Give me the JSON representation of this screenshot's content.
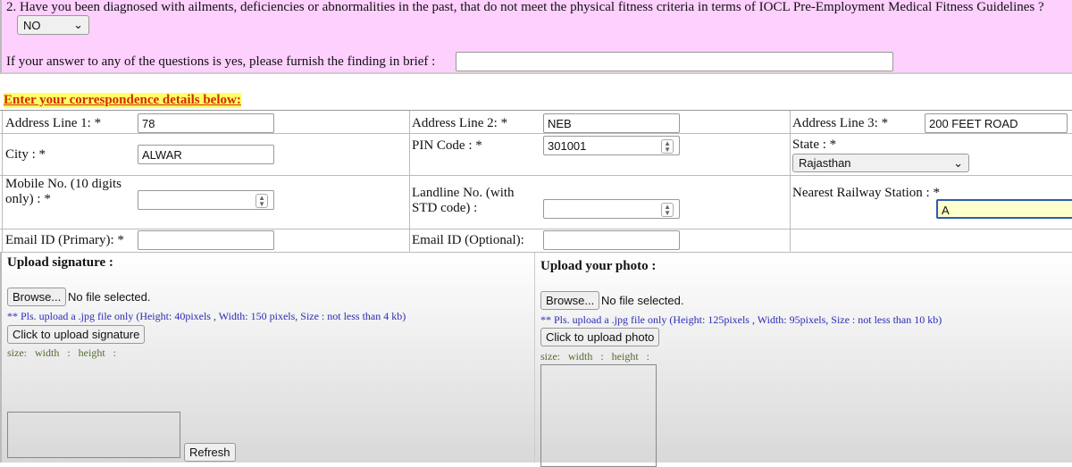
{
  "medical": {
    "question": "2. Have you been diagnosed with ailments, deficiencies or abnormalities in the past, that do not meet the physical fitness criteria in terms of IOCL Pre-Employment Medical Fitness Guidelines ?",
    "answer": "NO",
    "finding_label": "If your answer to any of the questions is yes, please furnish the finding in brief :",
    "finding_value": ""
  },
  "correspondence": {
    "heading": "Enter your correspondence details below:",
    "address1_label": "Address Line 1: *",
    "address1": "78",
    "address2_label": "Address Line 2: *",
    "address2": "NEB",
    "address3_label": "Address Line 3: *",
    "address3": "200 FEET ROAD",
    "city_label": "City : *",
    "city": "ALWAR",
    "pin_label": "PIN Code : *",
    "pin": "301001",
    "state_label": "State : *",
    "state": "Rajasthan",
    "mobile_label": "Mobile No. (10 digits only) : *",
    "mobile": "",
    "landline_label": "Landline No. (with STD code) :",
    "landline": "",
    "railway_label": "Nearest Railway Station : *",
    "railway": "A",
    "email1_label": "Email ID (Primary): *",
    "email1": "",
    "email2_label": "Email ID (Optional):",
    "email2": ""
  },
  "signature": {
    "title": "Upload signature :",
    "browse": "Browse...",
    "file_status": "No file selected.",
    "note": "** Pls. upload a .jpg file only (Height: 40pixels , Width: 150 pixels, Size : not less than 4 kb)",
    "upload": "Click to upload signature",
    "size_info": "size:  width :  height :",
    "refresh": "Refresh"
  },
  "photo": {
    "title": "Upload your photo :",
    "browse": "Browse...",
    "file_status": "No file selected.",
    "note": "** Pls. upload a .jpg file only (Height: 125pixels , Width: 95pixels, Size : not less than 10 kb)",
    "upload": "Click to upload photo",
    "size_info": "size:  width :  height :"
  },
  "colors": {
    "pink_bg": "#fdd0fd",
    "heading_color": "#d42a00",
    "heading_bg": "#ffff66",
    "note_color": "#2b2bb5"
  }
}
